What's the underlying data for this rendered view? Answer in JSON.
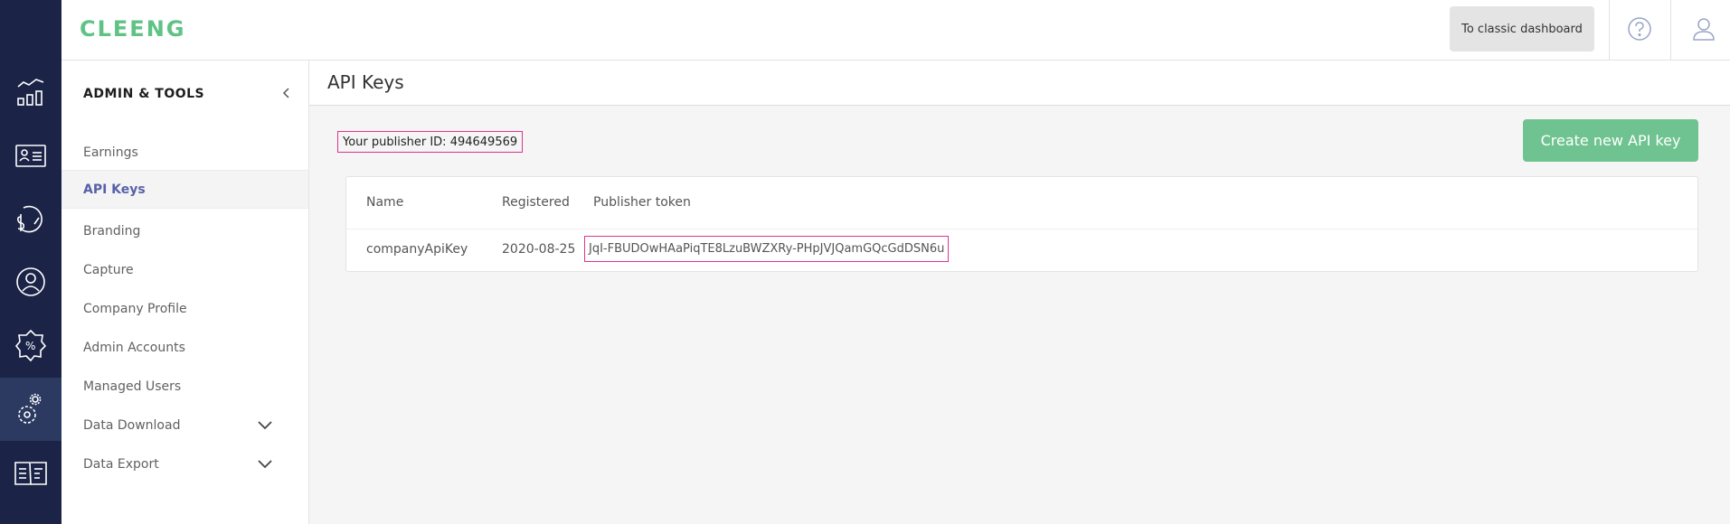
{
  "header": {
    "logo_text": "CLEENG",
    "classic_dashboard_label": "To classic dashboard",
    "help_icon": "question-circle-icon",
    "user_icon": "user-icon"
  },
  "rail": {
    "items": [
      {
        "icon": "analytics-chart-icon"
      },
      {
        "icon": "customer-card-icon"
      },
      {
        "icon": "revenue-speedometer-icon"
      },
      {
        "icon": "retention-user-icon"
      },
      {
        "icon": "discount-badge-icon"
      },
      {
        "icon": "settings-gear-icon",
        "active": true
      },
      {
        "icon": "documentation-book-icon"
      }
    ]
  },
  "subnav": {
    "title": "ADMIN & TOOLS",
    "items": [
      {
        "label": "Earnings"
      },
      {
        "label": "API Keys",
        "active": true
      },
      {
        "label": "Branding"
      },
      {
        "label": "Capture"
      },
      {
        "label": "Company Profile"
      },
      {
        "label": "Admin Accounts"
      },
      {
        "label": "Managed Users"
      },
      {
        "label": "Data Download",
        "expandable": true
      },
      {
        "label": "Data Export",
        "expandable": true
      }
    ]
  },
  "main": {
    "page_title": "API Keys",
    "publisher_id_text": "Your publisher ID: 494649569",
    "create_button_label": "Create new API key",
    "table": {
      "headers": [
        "Name",
        "Registered",
        "Publisher token"
      ],
      "rows": [
        {
          "name": "companyApiKey",
          "registered": "2020-08-25",
          "token": "JqI-FBUDOwHAaPiqTE8LzuBWZXRy-PHpJVJQamGQcGdDSN6u"
        }
      ]
    }
  },
  "colors": {
    "rail_bg": "#1b2447",
    "accent_green": "#6fc390",
    "logo_green": "#5ec384",
    "active_nav": "#5661a8",
    "highlight_border": "#e0338e"
  }
}
